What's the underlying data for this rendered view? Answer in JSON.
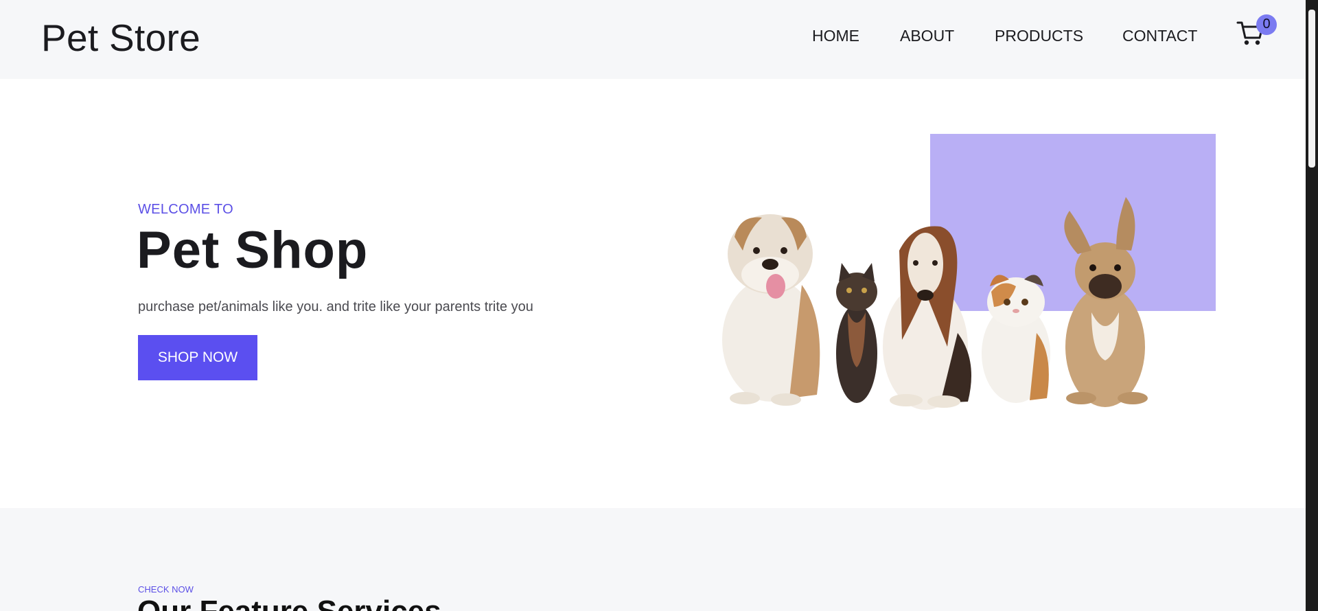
{
  "header": {
    "brand": "Pet Store",
    "nav": [
      {
        "label": "HOME"
      },
      {
        "label": "ABOUT"
      },
      {
        "label": "PRODUCTS"
      },
      {
        "label": "CONTACT"
      }
    ],
    "cart": {
      "icon": "cart-icon",
      "count": "0"
    }
  },
  "hero": {
    "eyebrow": "WELCOME TO",
    "title": "Pet Shop",
    "subtitle": "purchase pet/animals like you. and trite like your parents trite you",
    "cta_label": "SHOP NOW",
    "illustration": "bulldog, kitten, basset hound, persian cat and french bulldog sitting in a row"
  },
  "features": {
    "eyebrow": "CHECK NOW",
    "title": "Our Feature Services"
  },
  "colors": {
    "accent": "#5b4ff0",
    "accent_light": "#b9aff5",
    "badge": "#7b7bf1",
    "header_bg": "#f6f7f9",
    "text": "#1b1b1f"
  }
}
